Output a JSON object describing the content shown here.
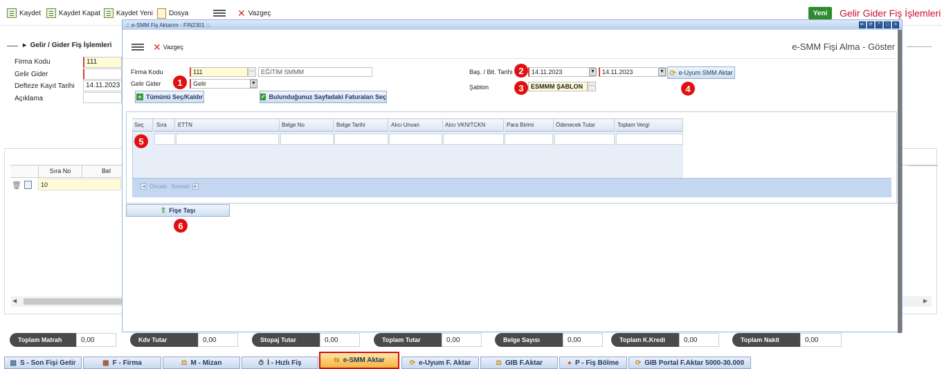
{
  "toolbar": {
    "kaydet": "Kaydet",
    "kaydet_kapat": "Kaydet Kapat",
    "kaydet_yeni": "Kaydet Yeni",
    "dosya": "Dosya",
    "vazgec": "Vazgeç",
    "yeni": "Yeni",
    "page_title": "Gelir Gider Fiş İşlemleri"
  },
  "bg_form": {
    "breadcrumb": "Gelir / Gider Fiş İşlemleri",
    "firma_kodu_label": "Firma Kodu",
    "firma_kodu_value": "111",
    "gelir_gider_label": "Gelir Gider",
    "defter_label": "Defteze Kayıt Tarihi",
    "defter_value": "14.11.2023",
    "aciklama_label": "Açıklama",
    "grid_col_sira": "Sıra No",
    "grid_col_bel": "Bel",
    "grid_row_sira": "10"
  },
  "totals": [
    {
      "label": "Toplam Matrah",
      "value": "0,00"
    },
    {
      "label": "Kdv Tutar",
      "value": "0,00"
    },
    {
      "label": "Stopaj Tutar",
      "value": "0,00"
    },
    {
      "label": "Toplam Tutar",
      "value": "0,00"
    },
    {
      "label": "Belge Sayısı",
      "value": "0,00"
    },
    {
      "label": "Toplam K.Kredi",
      "value": "0,00"
    },
    {
      "label": "Toplam Nakit",
      "value": "0,00"
    }
  ],
  "bottom_tabs": [
    {
      "label": "S - Son Fişi Getir",
      "icon": "list-icon"
    },
    {
      "label": "F - Firma",
      "icon": "factory-icon"
    },
    {
      "label": "M - Mizan",
      "icon": "scale-icon"
    },
    {
      "label": "İ - Hızlı Fiş",
      "icon": "clock-icon"
    },
    {
      "label": "e-SMM Aktar",
      "icon": "transfer-icon"
    },
    {
      "label": "e-Uyum F. Aktar",
      "icon": "sync-icon"
    },
    {
      "label": "GIB F.Aktar",
      "icon": "scale-icon"
    },
    {
      "label": "P - Fiş Bölme",
      "icon": "dot-icon"
    },
    {
      "label": "GIB Portal F.Aktar 5000-30.000",
      "icon": "sync-icon"
    }
  ],
  "modal": {
    "title": ".:: e-SMM Fiş Aktarım - FIN2301 ::.",
    "vazgec": "Vazgeç",
    "subtitle": "e-SMM Fişi Alma - Göster",
    "firma_kodu_label": "Firma Kodu",
    "firma_kodu_value": "111",
    "firma_adi": "EĞİTİM SMMM",
    "gelir_gider_label": "Gelir Gider",
    "gelir_gider_value": "Gelir",
    "tumunu_sec": "Tümünü Seç/Kaldır",
    "bulundugunuz": "Bulunduğunuz Sayfadaki Faturaları Seç",
    "bas_bit_label": "Baş. / Bit. Tarihi",
    "bas_tarih": "14.11.2023",
    "bit_tarih": "14.11.2023",
    "euyum_btn": "e-Uyum SMM Aktar",
    "sablon_label": "Şablon",
    "sablon_value": "ESMMM ŞABLON",
    "grid_headers": [
      "Seç",
      "Sıra",
      "ETTN",
      "Belge No",
      "Belge Tarihi",
      "Alıcı Unvan",
      "Alıcı VKN/TCKN",
      "Para Birimi",
      "Ödenecek Tutar",
      "Toplam Vergi"
    ],
    "onceki": "Önceki",
    "sonraki": "Sonraki",
    "fise_tasi": "Fişe Taşı"
  },
  "markers": [
    "1",
    "2",
    "3",
    "4",
    "5",
    "6"
  ],
  "colors": {
    "accent_red": "#c8102e",
    "marker_red": "#e01010",
    "header_blue": "#b9d0ef",
    "active_tab": "#f5b442"
  }
}
